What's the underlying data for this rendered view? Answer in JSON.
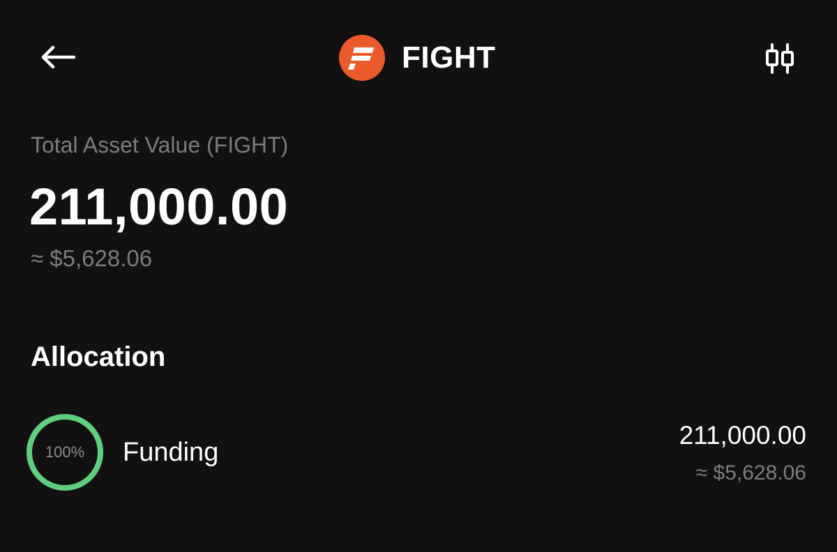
{
  "header": {
    "back_icon": "arrow-left-icon",
    "token_icon": "fight-logo-icon",
    "token_name": "FIGHT",
    "chart_icon": "candlestick-chart-icon"
  },
  "total": {
    "label": "Total Asset Value (FIGHT)",
    "value": "211,000.00",
    "fiat": "≈ $5,628.06"
  },
  "allocation": {
    "title": "Allocation",
    "items": [
      {
        "percent_label": "100%",
        "percent": 100,
        "name": "Funding",
        "amount": "211,000.00",
        "fiat": "≈ $5,628.06"
      }
    ]
  },
  "colors": {
    "background": "#111111",
    "brand": "#ea5a2a",
    "ring": "#5fcf7f",
    "muted_text": "#7c7c7c"
  }
}
